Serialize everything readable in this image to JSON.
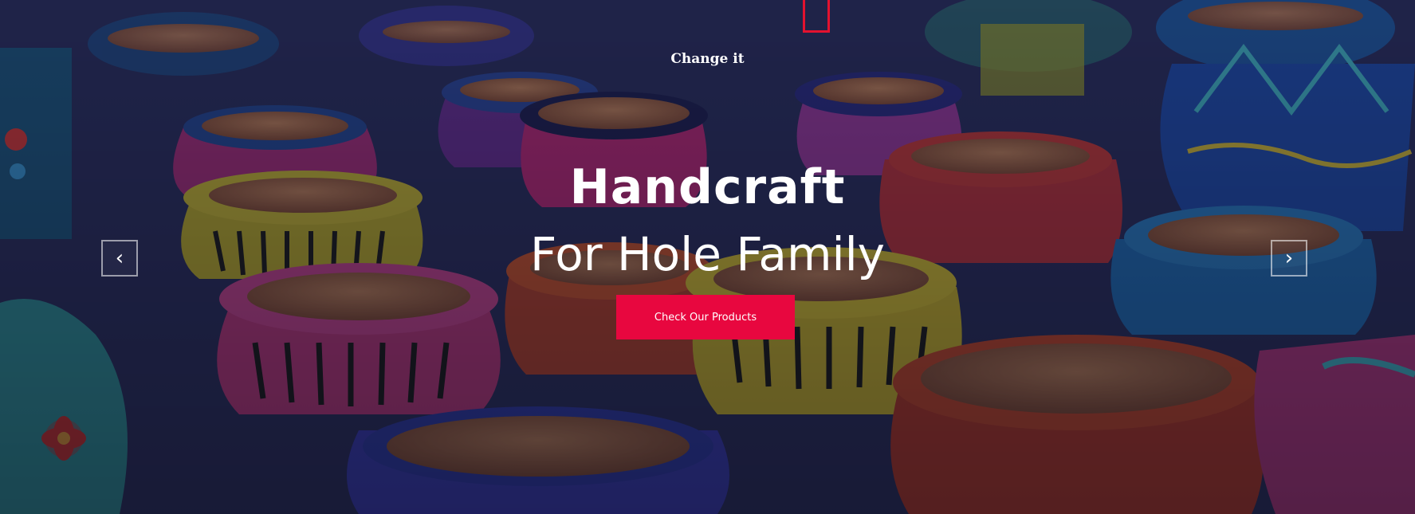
{
  "hero": {
    "top_label": "Change it",
    "title": "Handcraft",
    "subtitle": "For Hole Family",
    "cta_label": "Check Our Products",
    "cta_color": "#e8073f",
    "prev_icon": "‹",
    "next_icon": "›"
  }
}
